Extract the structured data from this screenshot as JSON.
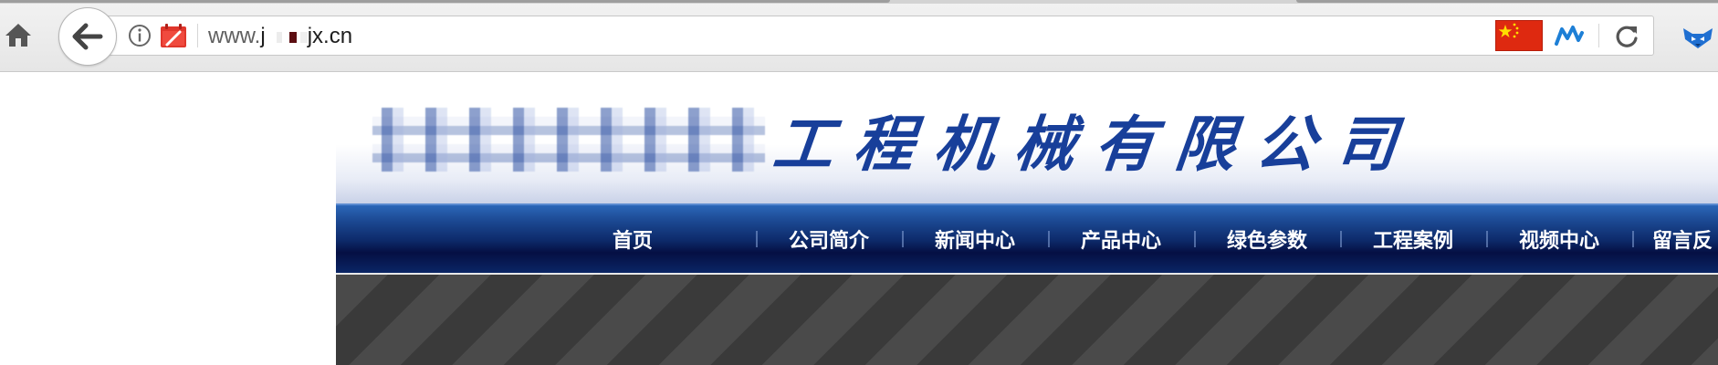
{
  "browser": {
    "url_prefix": "www.",
    "url_fragment": "j",
    "url_domain": "jx.cn",
    "icons": {
      "home": "home-icon",
      "back": "back-arrow-icon",
      "info": "info-icon",
      "calendar": "calendar-icon",
      "flag": "china-flag-icon",
      "network": "network-icon",
      "reload": "reload-icon",
      "extension": "fox-extension-icon"
    }
  },
  "site": {
    "logo_text": "工程机械有限公司",
    "nav": [
      {
        "label": "首页"
      },
      {
        "label": "公司简介"
      },
      {
        "label": "新闻中心"
      },
      {
        "label": "产品中心"
      },
      {
        "label": "绿色参数"
      },
      {
        "label": "工程案例"
      },
      {
        "label": "视频中心"
      },
      {
        "label": "留言反"
      }
    ],
    "colors": {
      "logo": "#183f9a",
      "nav_bg": "#050f43",
      "nav_text": "#ffffff",
      "banner_stripe_dark": "#3a3a3a",
      "banner_stripe_light": "#4a4a4a"
    }
  }
}
